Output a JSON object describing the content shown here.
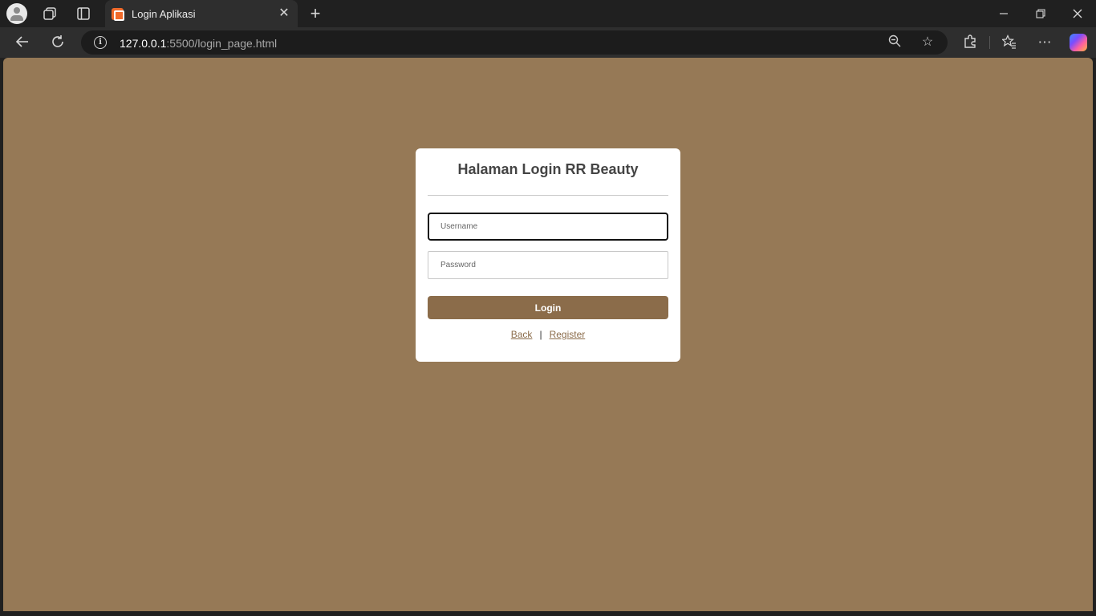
{
  "browser": {
    "tab_title": "Login Aplikasi",
    "url_host": "127.0.0.1",
    "url_path": ":5500/login_page.html",
    "icons": {
      "profile": "profile-avatar-icon",
      "workspaces": "workspaces-icon",
      "tab_actions": "tab-actions-icon",
      "favicon": "xampp-favicon-icon",
      "tab_close": "close-icon",
      "new_tab": "plus-icon",
      "minimize": "minimize-icon",
      "restore": "restore-icon",
      "window_close": "close-icon",
      "back": "back-arrow-icon",
      "refresh": "refresh-icon",
      "site_info": "info-icon",
      "zoom": "zoom-out-icon",
      "favorite": "star-icon",
      "extensions": "puzzle-icon",
      "favorites": "favorites-list-icon",
      "more": "more-icon",
      "copilot": "copilot-icon"
    }
  },
  "page": {
    "background_color": "#967956",
    "accent_color": "#8b6c4a",
    "login": {
      "title": "Halaman Login RR Beauty",
      "username_placeholder": "Username",
      "password_placeholder": "Password",
      "login_label": "Login",
      "back_label": "Back",
      "separator": "|",
      "register_label": "Register"
    }
  }
}
